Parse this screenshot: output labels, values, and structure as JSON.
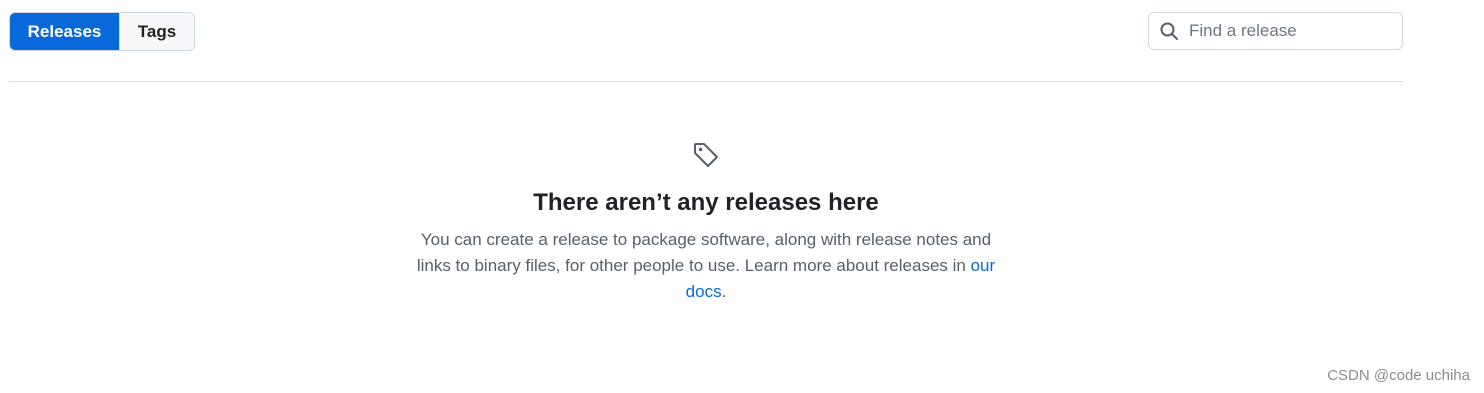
{
  "tabs": {
    "releases_label": "Releases",
    "tags_label": "Tags"
  },
  "search": {
    "placeholder": "Find a release",
    "value": ""
  },
  "empty_state": {
    "icon": "tag-icon",
    "title": "There aren’t any releases here",
    "body_text": "You can create a release to package software, along with release notes and links to binary files, for other people to use. Learn more about releases in ",
    "link_text": "our docs",
    "trailing_text": "."
  },
  "watermark": {
    "text": "CSDN @code uchiha"
  },
  "colors": {
    "accent": "#0969da",
    "border": "#d0d7de",
    "text_primary": "#1f2328",
    "text_muted": "#57606a"
  }
}
